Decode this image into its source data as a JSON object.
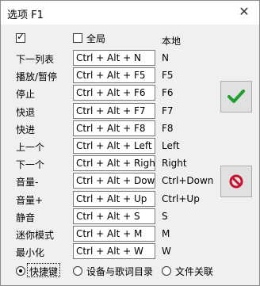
{
  "window": {
    "title": "选项 F1",
    "close_glyph": "✕"
  },
  "header": {
    "global_label": "全局",
    "local_label": "本地",
    "global_checked": true
  },
  "rows": [
    {
      "label": "下一列表",
      "hotkey": "Ctrl + Alt + N",
      "local": "N"
    },
    {
      "label": "播放/暂停",
      "hotkey": "Ctrl + Alt + F5",
      "local": "F5"
    },
    {
      "label": "停止",
      "hotkey": "Ctrl + Alt + F6",
      "local": "F6"
    },
    {
      "label": "快退",
      "hotkey": "Ctrl + Alt + F7",
      "local": "F7"
    },
    {
      "label": "快进",
      "hotkey": "Ctrl + Alt + F8",
      "local": "F8"
    },
    {
      "label": "上一个",
      "hotkey": "Ctrl + Alt + Left",
      "local": "Left"
    },
    {
      "label": "下一个",
      "hotkey": "Ctrl + Alt + Right",
      "local": "Right"
    },
    {
      "label": "音量-",
      "hotkey": "Ctrl + Alt + Down",
      "local": "Ctrl+Down"
    },
    {
      "label": "音量+",
      "hotkey": "Ctrl + Alt + Up",
      "local": "Ctrl+Up"
    },
    {
      "label": "静音",
      "hotkey": "Ctrl + Alt + S",
      "local": "S"
    },
    {
      "label": "迷你模式",
      "hotkey": "Ctrl + Alt + M",
      "local": "M"
    },
    {
      "label": "最小化",
      "hotkey": "Ctrl + Alt + W",
      "local": "W"
    }
  ],
  "buttons": {
    "ok_icon": "green-checkmark-icon",
    "cancel_icon": "red-prohibited-icon",
    "ok_color": "#1e9e2a",
    "cancel_color": "#c8102e"
  },
  "tabs": [
    {
      "label": "快捷键",
      "selected": true
    },
    {
      "label": "设备与歌词目录",
      "selected": false
    },
    {
      "label": "文件关联",
      "selected": false
    }
  ]
}
